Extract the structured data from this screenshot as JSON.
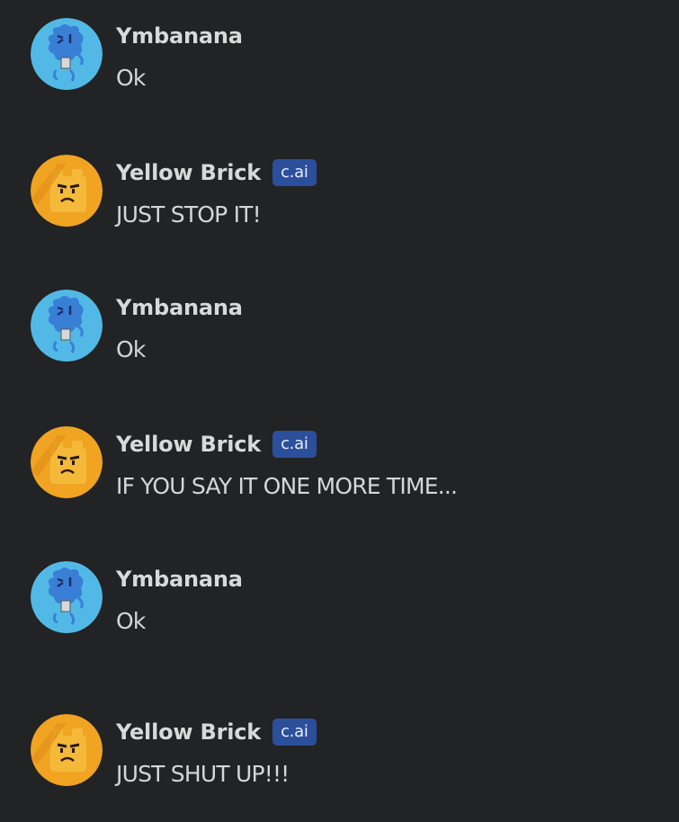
{
  "chat": {
    "messages": [
      {
        "author": "Ymbanana",
        "text": "Ok",
        "avatar_icon": "blue-fluffy-character-avatar",
        "badge": ""
      },
      {
        "author": "Yellow Brick",
        "text": "JUST STOP IT!",
        "avatar_icon": "yellow-brick-angry-avatar",
        "badge": "c.ai"
      },
      {
        "author": "Ymbanana",
        "text": "Ok",
        "avatar_icon": "blue-fluffy-character-avatar",
        "badge": ""
      },
      {
        "author": "Yellow Brick",
        "text": "IF YOU SAY IT ONE MORE TIME...",
        "avatar_icon": "yellow-brick-angry-avatar",
        "badge": "c.ai"
      },
      {
        "author": "Ymbanana",
        "text": "Ok",
        "avatar_icon": "blue-fluffy-character-avatar",
        "badge": ""
      },
      {
        "author": "Yellow Brick",
        "text": "JUST SHUT UP!!!",
        "avatar_icon": "yellow-brick-angry-avatar",
        "badge": "c.ai"
      }
    ]
  },
  "colors": {
    "background": "#222324",
    "badge_background": "#2c4f9c",
    "user_avatar_bg": "#4fb8e6",
    "bot_avatar_bg": "#f0a422"
  }
}
